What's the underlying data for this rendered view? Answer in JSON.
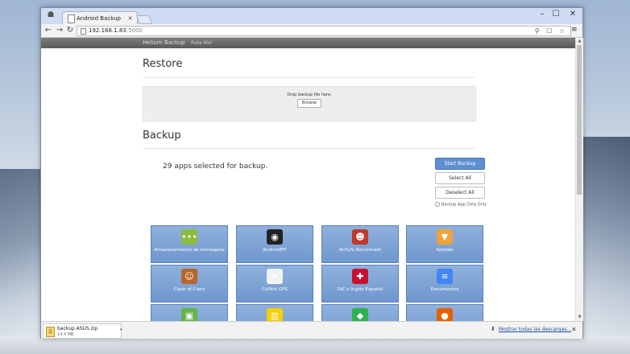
{
  "window": {
    "tab_title": "Android Backup",
    "tab_close": "×",
    "controls": {
      "minimize": "–",
      "maximize": "☐",
      "close": "✕"
    }
  },
  "toolbar": {
    "back": "←",
    "forward": "→",
    "reload": "↻",
    "url_host": "192.168.1.83",
    "url_port": ":5000",
    "icons": "⚲ ☐ ☆",
    "menu": "≡"
  },
  "navbar": {
    "brand": "Helium Backup",
    "rate": "Rate Me!"
  },
  "restore": {
    "heading": "Restore",
    "drop_text": "Drop backup file here.",
    "browse_label": "Browse"
  },
  "backup": {
    "heading": "Backup",
    "selected_text": "29 apps selected for backup.",
    "start_label": "Start Backup",
    "select_all_label": "Select All",
    "deselect_all_label": "Deselect All",
    "app_data_only_label": "Backup App Data Only"
  },
  "apps": [
    {
      "name": "Almacenamiento de mensajería",
      "icon": "speech-bubble-icon",
      "color": "#8dbb3e",
      "glyph": "•••"
    },
    {
      "name": "AndroidPIT",
      "icon": "androidpit-icon",
      "color": "#222222",
      "glyph": "◉"
    },
    {
      "name": "AnTuTu Benchmark",
      "icon": "antutu-icon",
      "color": "#c0392b",
      "glyph": "☻"
    },
    {
      "name": "Aptoide",
      "icon": "aptoide-icon",
      "color": "#f0a23b",
      "glyph": "▼"
    },
    {
      "name": "Clash of Clans",
      "icon": "clash-of-clans-icon",
      "color": "#b8672a",
      "glyph": "☺"
    },
    {
      "name": "CoPilot GPS",
      "icon": "copilot-gps-icon",
      "color": "#f2f2f2",
      "glyph": "➤"
    },
    {
      "name": "DIC o Inglés Español",
      "icon": "dictionary-flags-icon",
      "color": "#c8102e",
      "glyph": "✚"
    },
    {
      "name": "Documentos",
      "icon": "documents-icon",
      "color": "#4285f4",
      "glyph": "≡"
    },
    {
      "name": "",
      "icon": "app-icon",
      "color": "#66b34a",
      "glyph": "▣"
    },
    {
      "name": "",
      "icon": "app-icon",
      "color": "#f5d000",
      "glyph": "▥"
    },
    {
      "name": "",
      "icon": "feedly-icon",
      "color": "#2bb24c",
      "glyph": "◆"
    },
    {
      "name": "",
      "icon": "firefox-icon",
      "color": "#e66000",
      "glyph": "●"
    }
  ],
  "downloads": {
    "file_name": "backup ASUS.zip",
    "file_size": "14.4 MB",
    "caret": "▾",
    "show_all_label": "Mostrar todas las descargas...",
    "close": "✕"
  }
}
